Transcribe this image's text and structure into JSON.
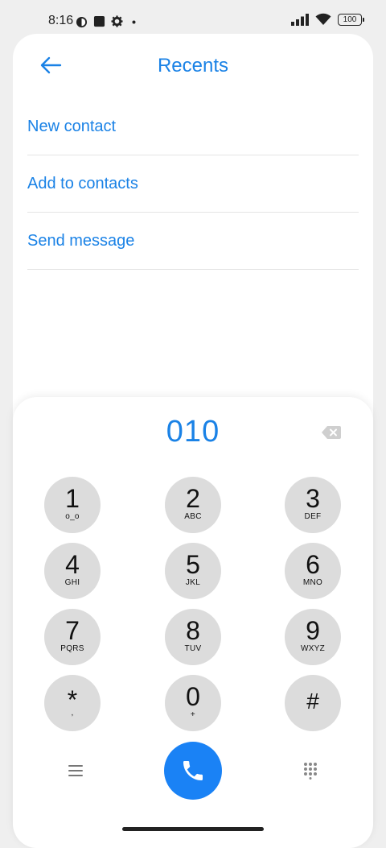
{
  "status_bar": {
    "time": "8:16",
    "battery": "100",
    "icons": [
      "clock-app-icon",
      "square-notification-icon",
      "gear-icon",
      "dot-icon",
      "signal-icon",
      "wifi-icon",
      "battery-icon"
    ]
  },
  "header": {
    "title": "Recents",
    "back_icon": "arrow-left-icon"
  },
  "menu": {
    "items": [
      {
        "label": "New contact"
      },
      {
        "label": "Add to contacts"
      },
      {
        "label": "Send message"
      }
    ]
  },
  "dialpad": {
    "number": "010",
    "keys": [
      {
        "digit": "1",
        "sub": "o_o"
      },
      {
        "digit": "2",
        "sub": "ABC"
      },
      {
        "digit": "3",
        "sub": "DEF"
      },
      {
        "digit": "4",
        "sub": "GHI"
      },
      {
        "digit": "5",
        "sub": "JKL"
      },
      {
        "digit": "6",
        "sub": "MNO"
      },
      {
        "digit": "7",
        "sub": "PQRS"
      },
      {
        "digit": "8",
        "sub": "TUV"
      },
      {
        "digit": "9",
        "sub": "WXYZ"
      },
      {
        "digit": "*",
        "sub": ","
      },
      {
        "digit": "0",
        "sub": "+"
      },
      {
        "digit": "#",
        "sub": ""
      }
    ]
  },
  "colors": {
    "accent": "#1a82e6",
    "key_bg": "#dcdcdc",
    "call_button": "#1a82f5"
  }
}
